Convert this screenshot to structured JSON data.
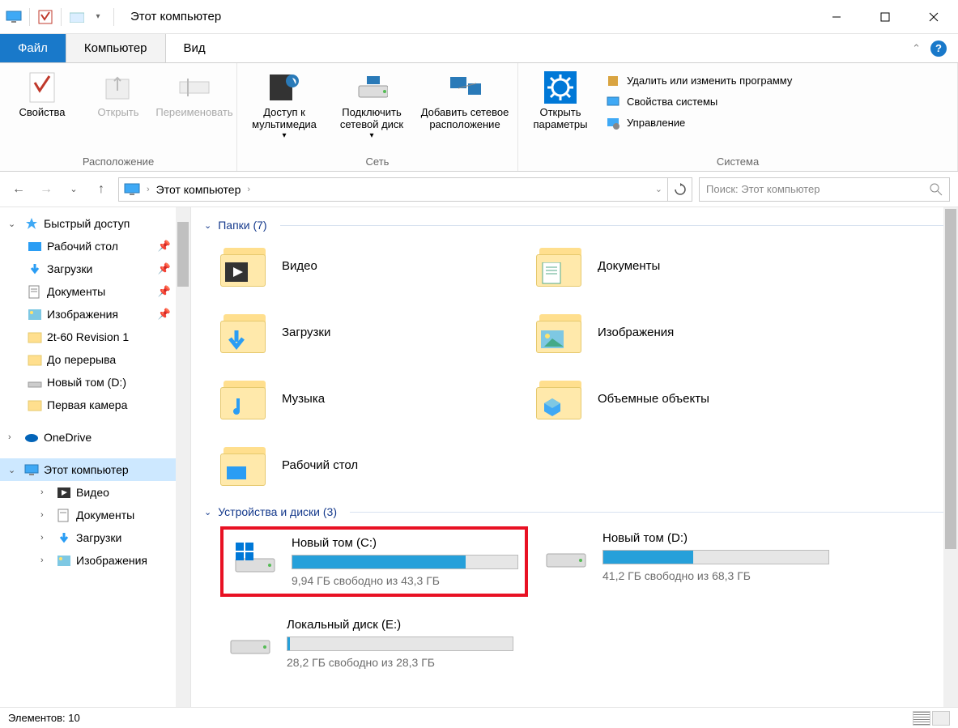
{
  "window": {
    "title": "Этот компьютер"
  },
  "tabs": {
    "file": "Файл",
    "computer": "Компьютер",
    "view": "Вид"
  },
  "ribbon": {
    "location": {
      "properties": "Свойства",
      "open": "Открыть",
      "rename": "Переименовать",
      "group_label": "Расположение"
    },
    "network": {
      "media": "Доступ к мультимедиа",
      "map": "Подключить сетевой диск",
      "addloc": "Добавить сетевое расположение",
      "group_label": "Сеть"
    },
    "system": {
      "settings": "Открыть параметры",
      "uninstall": "Удалить или изменить программу",
      "sysprops": "Свойства системы",
      "manage": "Управление",
      "group_label": "Система"
    }
  },
  "nav": {
    "refresh_tooltip": "Обновить"
  },
  "address": {
    "current": "Этот компьютер"
  },
  "search": {
    "placeholder": "Поиск: Этот компьютер"
  },
  "sidebar": {
    "quick_access": "Быстрый доступ",
    "items_qa": [
      {
        "label": "Рабочий стол",
        "pinned": true
      },
      {
        "label": "Загрузки",
        "pinned": true
      },
      {
        "label": "Документы",
        "pinned": true
      },
      {
        "label": "Изображения",
        "pinned": true
      },
      {
        "label": "2t-60 Revision 1",
        "pinned": false
      },
      {
        "label": "До перерыва",
        "pinned": false
      },
      {
        "label": "Новый том (D:)",
        "pinned": false
      },
      {
        "label": "Первая камера",
        "pinned": false
      }
    ],
    "onedrive": "OneDrive",
    "this_pc": "Этот компьютер",
    "items_pc": [
      {
        "label": "Видео"
      },
      {
        "label": "Документы"
      },
      {
        "label": "Загрузки"
      },
      {
        "label": "Изображения"
      }
    ]
  },
  "content": {
    "folders_header": "Папки (7)",
    "folders": [
      {
        "name": "Видео",
        "overlay": "video"
      },
      {
        "name": "Документы",
        "overlay": "doc"
      },
      {
        "name": "Загрузки",
        "overlay": "down"
      },
      {
        "name": "Изображения",
        "overlay": "img"
      },
      {
        "name": "Музыка",
        "overlay": "music"
      },
      {
        "name": "Объемные объекты",
        "overlay": "3d"
      },
      {
        "name": "Рабочий стол",
        "overlay": "desk"
      }
    ],
    "drives_header": "Устройства и диски (3)",
    "drives": [
      {
        "name": "Новый том (C:)",
        "info": "9,94 ГБ свободно из 43,3 ГБ",
        "fill_pct": 77,
        "os": true,
        "highlighted": true
      },
      {
        "name": "Новый том (D:)",
        "info": "41,2 ГБ свободно из 68,3 ГБ",
        "fill_pct": 40,
        "os": false,
        "highlighted": false
      },
      {
        "name": "Локальный диск (E:)",
        "info": "28,2 ГБ свободно из 28,3 ГБ",
        "fill_pct": 1,
        "os": false,
        "highlighted": false
      }
    ]
  },
  "status": {
    "elements": "Элементов: 10"
  }
}
